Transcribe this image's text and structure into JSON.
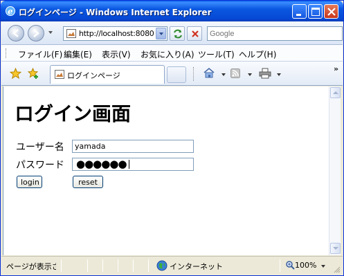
{
  "window": {
    "title": "ログインページ - Windows Internet Explorer"
  },
  "nav": {
    "address": "http://localhost:8080",
    "search_placeholder": "Google"
  },
  "menu": {
    "items": [
      "ファイル(F)",
      "編集(E)",
      "表示(V)",
      "お気に入り(A)",
      "ツール(T)",
      "ヘルプ(H)"
    ]
  },
  "tabs": {
    "active_label": "ログインページ"
  },
  "page": {
    "title": "ログイン画面",
    "username_label": "ユーザー名",
    "username_value": "yamada",
    "password_label": "パスワード",
    "password_mask": "●●●●●●",
    "login_label": "login",
    "reset_label": "reset"
  },
  "status": {
    "text": "ページが表示されました",
    "zone": "インターネット",
    "zoom": "100%"
  },
  "colors": {
    "titlebar": "#0b58e0",
    "accent": "#0831d9"
  }
}
